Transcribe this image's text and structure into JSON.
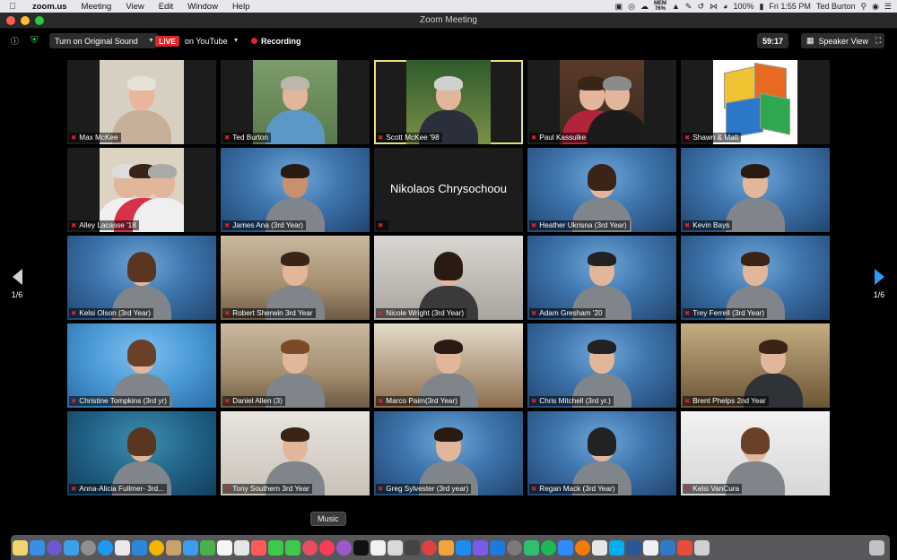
{
  "menubar": {
    "app": "zoom.us",
    "items": [
      "Meeting",
      "View",
      "Edit",
      "Window",
      "Help"
    ],
    "memory_label": "MEM",
    "memory_value": "76%",
    "battery": "100%",
    "clock": "Fri 1:55 PM",
    "user": "Ted Burton"
  },
  "window": {
    "title": "Zoom Meeting"
  },
  "toolbar": {
    "original_sound": "Turn on Original Sound",
    "live_badge": "LIVE",
    "live_target": "on YouTube",
    "recording": "Recording",
    "timer": "59:17",
    "view_mode": "Speaker View"
  },
  "pager": {
    "left": "1/6",
    "right": "1/6"
  },
  "participants": [
    {
      "name": "Max McKee"
    },
    {
      "name": "Ted Burton"
    },
    {
      "name": "Scott McKee '98"
    },
    {
      "name": "Paul Kassulke"
    },
    {
      "name": "Shawn & Matt"
    },
    {
      "name": "Alley Lacasse '18"
    },
    {
      "name": "James Ana (3rd Year)"
    },
    {
      "name": "Nikolaos Chrysochoou"
    },
    {
      "name": "Heather Ukrisna (3rd Year)"
    },
    {
      "name": "Kevin Bays"
    },
    {
      "name": "Kelsi Olson (3rd Year)"
    },
    {
      "name": "Robert Sherwin 3rd Year"
    },
    {
      "name": "Nicole Wright (3rd Year)"
    },
    {
      "name": "Adam Gresham '20"
    },
    {
      "name": "Trey Ferrell (3rd Year)"
    },
    {
      "name": "Christine Tompkins (3rd yr)"
    },
    {
      "name": "Daniel Allen (3)"
    },
    {
      "name": "Marco Paim(3rd Year)"
    },
    {
      "name": "Chris Mitchell (3rd yr.)"
    },
    {
      "name": "Brent Phelps 2nd Year"
    },
    {
      "name": "Anna-Alicia Fullmer- 3rd..."
    },
    {
      "name": "Tony Southern 3rd Year"
    },
    {
      "name": "Greg Sylvester (3rd year)"
    },
    {
      "name": "Regan Mack (3rd Year)"
    },
    {
      "name": "Kelsi VanCura"
    }
  ],
  "dock": {
    "tooltip": "Music"
  }
}
